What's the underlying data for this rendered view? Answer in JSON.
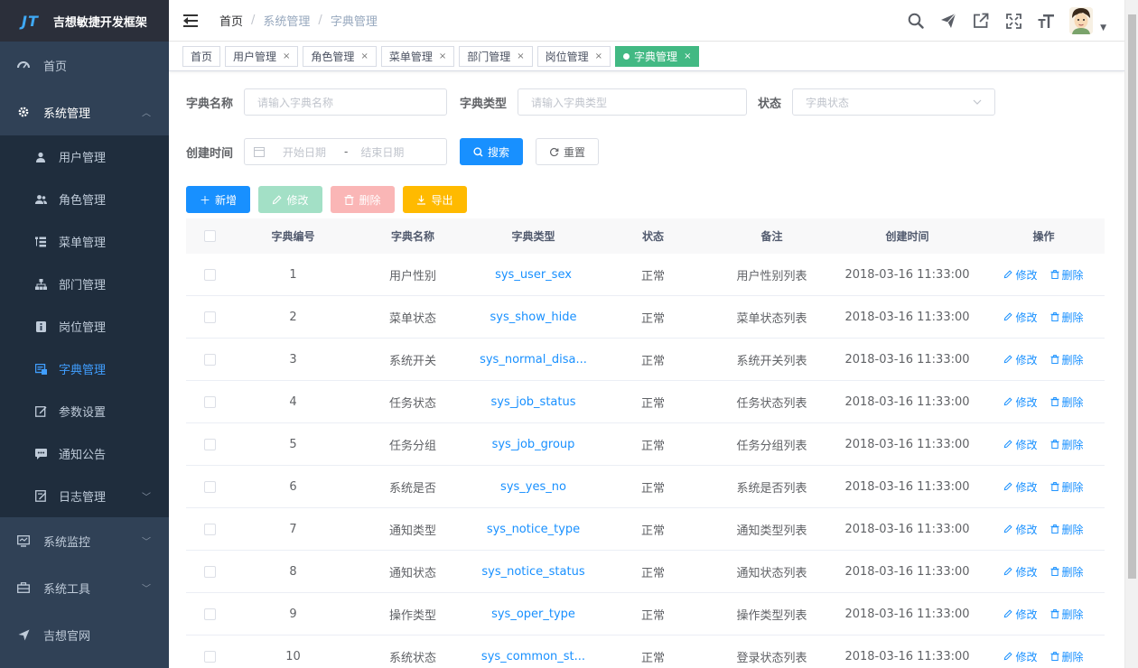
{
  "app": {
    "logo_mark": "JT",
    "title": "吉想敏捷开发框架"
  },
  "sidebar": {
    "home": "首页",
    "system": "系统管理",
    "items": [
      "用户管理",
      "角色管理",
      "菜单管理",
      "部门管理",
      "岗位管理",
      "字典管理",
      "参数设置",
      "通知公告",
      "日志管理"
    ],
    "monitor": "系统监控",
    "tools": "系统工具",
    "website": "吉想官网"
  },
  "breadcrumb": [
    "首页",
    "系统管理",
    "字典管理"
  ],
  "tags": [
    "首页",
    "用户管理",
    "角色管理",
    "菜单管理",
    "部门管理",
    "岗位管理",
    "字典管理"
  ],
  "search": {
    "dict_name_label": "字典名称",
    "dict_name_placeholder": "请输入字典名称",
    "dict_type_label": "字典类型",
    "dict_type_placeholder": "请输入字典类型",
    "status_label": "状态",
    "status_placeholder": "字典状态",
    "created_label": "创建时间",
    "start_placeholder": "开始日期",
    "range_sep": "-",
    "end_placeholder": "结束日期",
    "search_btn": "搜索",
    "reset_btn": "重置"
  },
  "toolbar": {
    "add": "新增",
    "edit": "修改",
    "delete": "删除",
    "export": "导出"
  },
  "table": {
    "headers": [
      "字典编号",
      "字典名称",
      "字典类型",
      "状态",
      "备注",
      "创建时间",
      "操作"
    ],
    "edit_label": "修改",
    "delete_label": "删除",
    "rows": [
      {
        "id": "1",
        "name": "用户性别",
        "type": "sys_user_sex",
        "status": "正常",
        "remark": "用户性别列表",
        "created": "2018-03-16 11:33:00"
      },
      {
        "id": "2",
        "name": "菜单状态",
        "type": "sys_show_hide",
        "status": "正常",
        "remark": "菜单状态列表",
        "created": "2018-03-16 11:33:00"
      },
      {
        "id": "3",
        "name": "系统开关",
        "type": "sys_normal_disa...",
        "status": "正常",
        "remark": "系统开关列表",
        "created": "2018-03-16 11:33:00"
      },
      {
        "id": "4",
        "name": "任务状态",
        "type": "sys_job_status",
        "status": "正常",
        "remark": "任务状态列表",
        "created": "2018-03-16 11:33:00"
      },
      {
        "id": "5",
        "name": "任务分组",
        "type": "sys_job_group",
        "status": "正常",
        "remark": "任务分组列表",
        "created": "2018-03-16 11:33:00"
      },
      {
        "id": "6",
        "name": "系统是否",
        "type": "sys_yes_no",
        "status": "正常",
        "remark": "系统是否列表",
        "created": "2018-03-16 11:33:00"
      },
      {
        "id": "7",
        "name": "通知类型",
        "type": "sys_notice_type",
        "status": "正常",
        "remark": "通知类型列表",
        "created": "2018-03-16 11:33:00"
      },
      {
        "id": "8",
        "name": "通知状态",
        "type": "sys_notice_status",
        "status": "正常",
        "remark": "通知状态列表",
        "created": "2018-03-16 11:33:00"
      },
      {
        "id": "9",
        "name": "操作类型",
        "type": "sys_oper_type",
        "status": "正常",
        "remark": "操作类型列表",
        "created": "2018-03-16 11:33:00"
      },
      {
        "id": "10",
        "name": "系统状态",
        "type": "sys_common_st...",
        "status": "正常",
        "remark": "登录状态列表",
        "created": "2018-03-16 11:33:00"
      }
    ]
  }
}
